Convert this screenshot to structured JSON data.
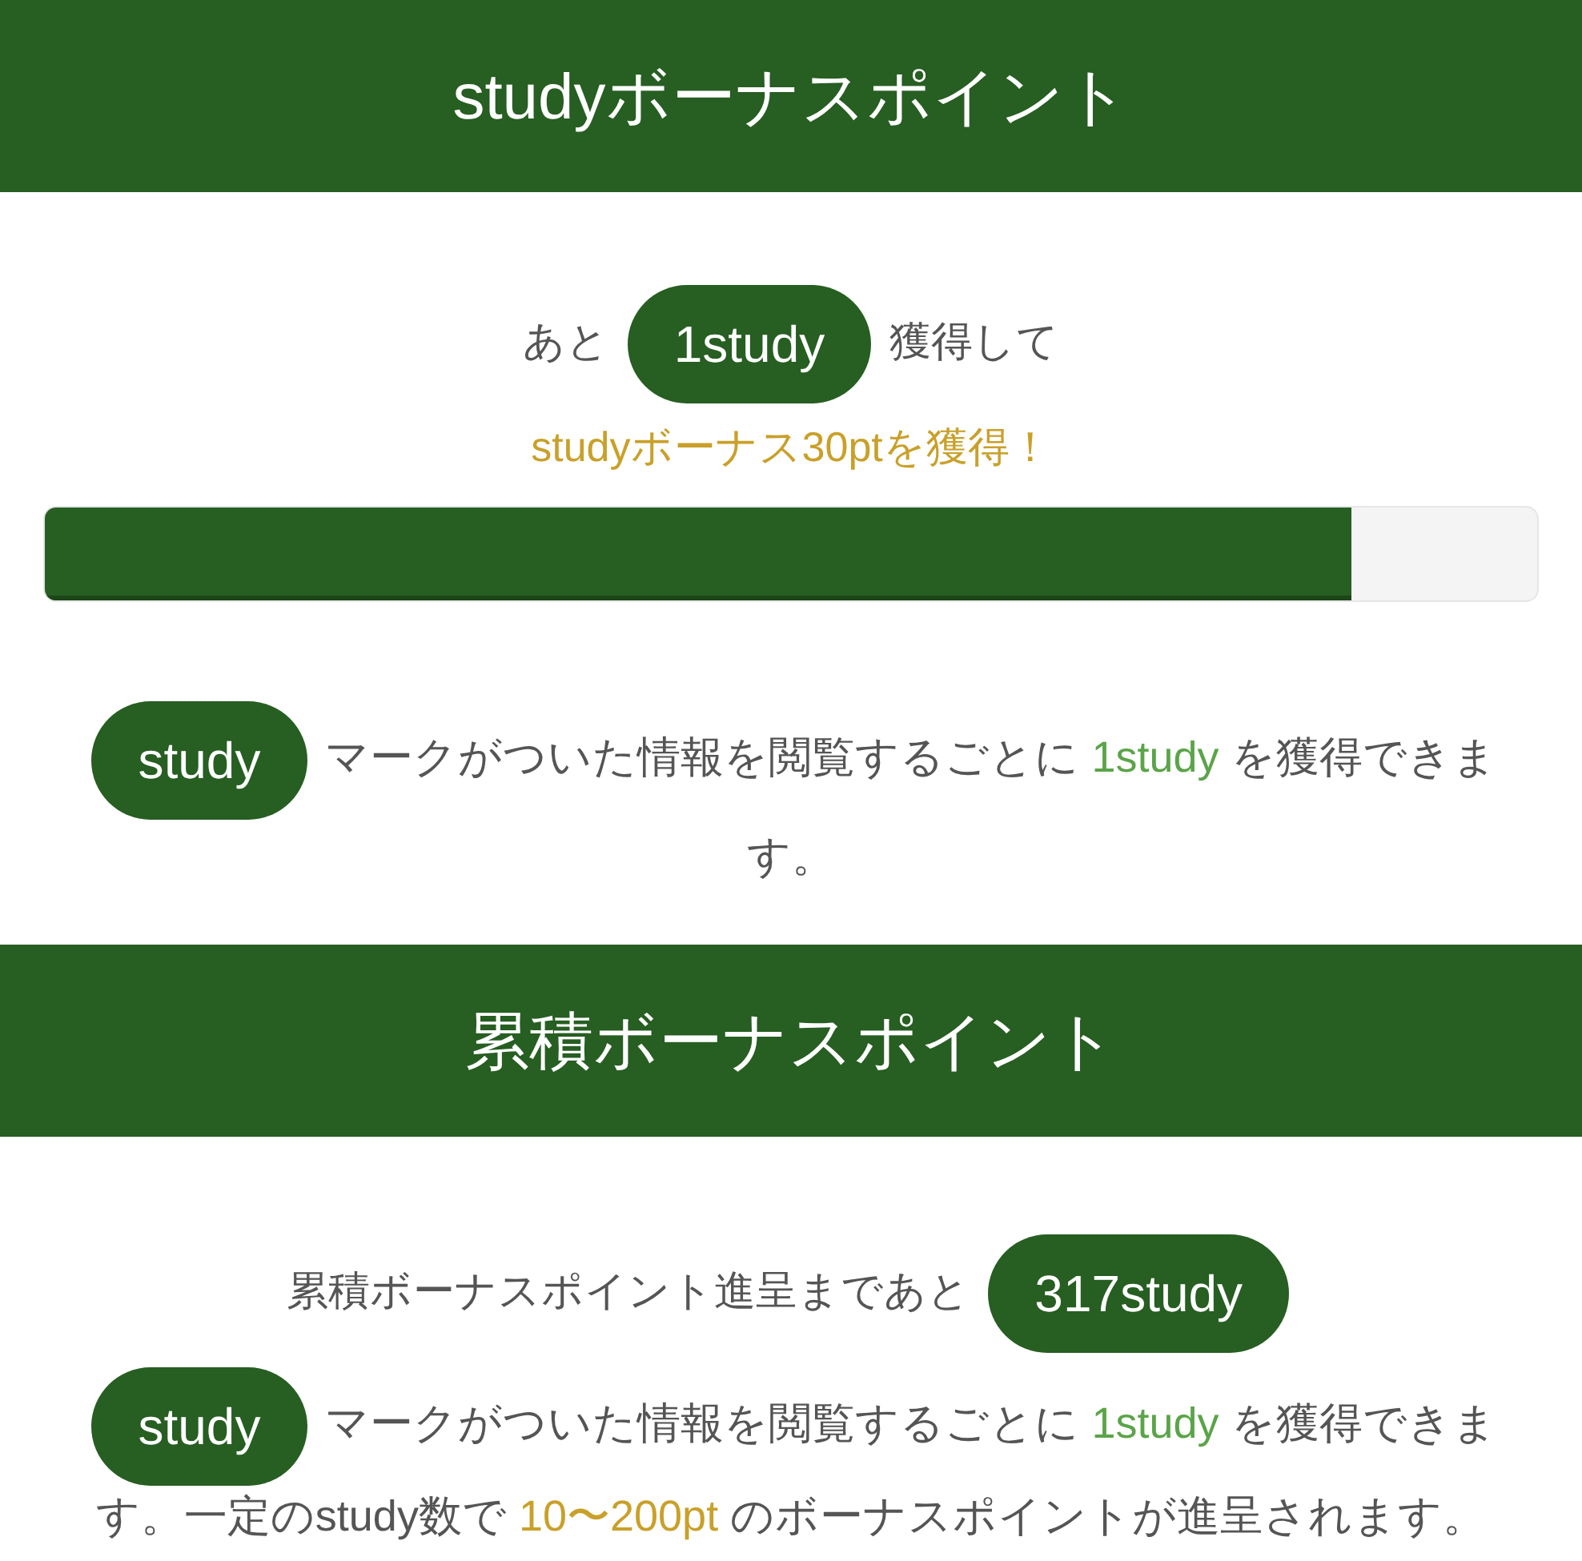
{
  "sections": [
    {
      "title": "studyボーナスポイント",
      "lines": [
        [
          {
            "kind": "plain",
            "text": "あと"
          },
          {
            "kind": "badge",
            "text": "1study"
          },
          {
            "kind": "plain",
            "text": "獲得して"
          }
        ],
        [
          {
            "kind": "gold",
            "text": "studyボーナス30ptを獲得！"
          }
        ]
      ],
      "progress": {
        "level": 0.876
      },
      "note": [
        [
          {
            "kind": "badge",
            "text": "study"
          },
          {
            "kind": "plain",
            "text": "マークがついた情報を閲覧するごとに"
          },
          {
            "kind": "green",
            "text": "1study"
          },
          {
            "kind": "plain",
            "text": "を獲得できま"
          }
        ],
        [
          {
            "kind": "plain",
            "text": "す。"
          }
        ]
      ]
    },
    {
      "title": "累積ボーナスポイント",
      "lines": [
        [
          {
            "kind": "plain",
            "text": "累積ボーナスポイント進呈まであと"
          },
          {
            "kind": "badge",
            "text": "317study"
          }
        ]
      ],
      "note": [
        [
          {
            "kind": "badge",
            "text": "study"
          },
          {
            "kind": "plain",
            "text": "マークがついた情報を閲覧するごとに"
          },
          {
            "kind": "green",
            "text": "1study"
          },
          {
            "kind": "plain",
            "text": "を獲得できま"
          }
        ],
        [
          {
            "kind": "plain",
            "text": "す。一定のstudy数で"
          },
          {
            "kind": "gold",
            "text": "10〜200pt"
          },
          {
            "kind": "plain",
            "text": "のボーナスポイントが進呈されます。"
          }
        ]
      ]
    }
  ]
}
